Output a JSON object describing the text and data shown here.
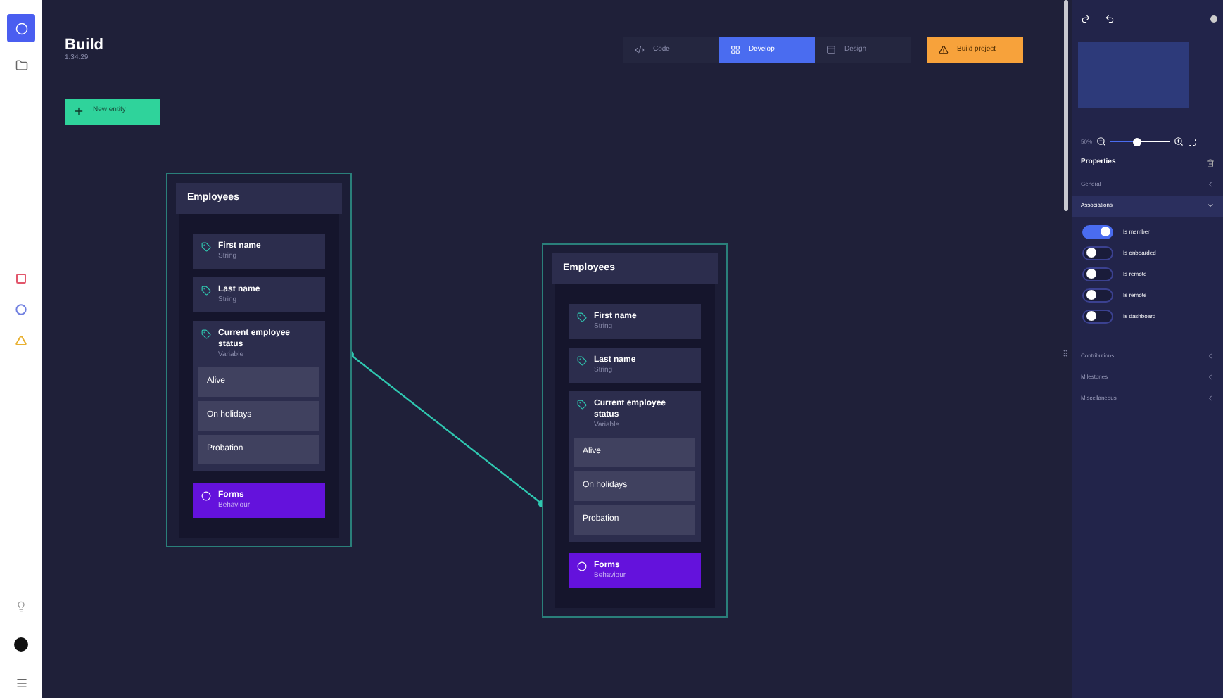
{
  "sidebar": {
    "items": [
      {
        "kind": "logo",
        "selected": true
      },
      {
        "kind": "folder",
        "selected": false
      }
    ],
    "shapes": [
      {
        "kind": "square",
        "color": "#e2566b"
      },
      {
        "kind": "circle",
        "color": "#6f7fe0"
      },
      {
        "kind": "triangle",
        "color": "#e8b030"
      }
    ]
  },
  "header": {
    "title": "Build",
    "version": "1.34.29",
    "new_button": "New entity"
  },
  "tabs": [
    {
      "label": "Code",
      "selected": false
    },
    {
      "label": "Develop",
      "selected": true
    },
    {
      "label": "Design",
      "selected": false
    }
  ],
  "build_button": "Build project",
  "entities": [
    {
      "title": "Employees",
      "fields": [
        {
          "kind": "field",
          "name": "First name",
          "type": "String"
        },
        {
          "kind": "field",
          "name": "Last name",
          "type": "String"
        },
        {
          "kind": "enum",
          "name": "Current employee status",
          "type": "Variable",
          "options": [
            "Alive",
            "On holidays",
            "Probation"
          ]
        }
      ],
      "form": {
        "name": "Forms",
        "type": "Behaviour"
      }
    },
    {
      "title": "Employees",
      "fields": [
        {
          "kind": "field",
          "name": "First name",
          "type": "String"
        },
        {
          "kind": "field",
          "name": "Last name",
          "type": "String"
        },
        {
          "kind": "enum",
          "name": "Current employee status",
          "type": "Variable",
          "options": [
            "Alive",
            "On holidays",
            "Probation"
          ]
        }
      ],
      "form": {
        "name": "Forms",
        "type": "Behaviour"
      }
    }
  ],
  "panel": {
    "zoom": {
      "reading": "50%",
      "level": 0.45
    },
    "title": "Properties",
    "sections": [
      {
        "label": "General",
        "expanded": false
      },
      {
        "label": "Associations",
        "expanded": true,
        "toggles": [
          {
            "label": "Is member",
            "on": true
          },
          {
            "label": "Is onboarded",
            "on": false
          },
          {
            "label": "Is remote",
            "on": false
          },
          {
            "label": "Is remote",
            "on": false
          },
          {
            "label": "Is dashboard",
            "on": false
          }
        ]
      },
      {
        "label": "Contributions",
        "expanded": false
      },
      {
        "label": "Milestones",
        "expanded": false
      },
      {
        "label": "Miscellaneous",
        "expanded": false
      }
    ]
  }
}
